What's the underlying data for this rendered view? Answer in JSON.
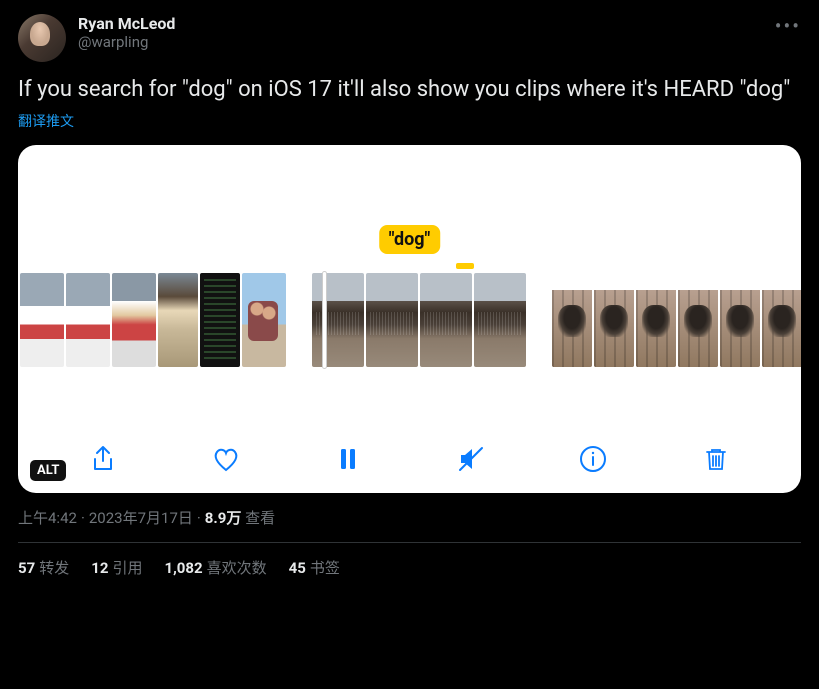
{
  "author": {
    "display_name": "Ryan McLeod",
    "handle": "@warpling"
  },
  "tweet_text": "If you search for \"dog\" on iOS 17 it'll also show you clips where it's HEARD \"dog\"",
  "translate_label": "翻译推文",
  "media": {
    "search_label": "\"dog\"",
    "alt_badge": "ALT"
  },
  "meta": {
    "time": "上午4:42",
    "date": "2023年7月17日",
    "views_number": "8.9万",
    "views_label": "查看"
  },
  "stats": {
    "retweets_num": "57",
    "retweets_label": "转发",
    "quotes_num": "12",
    "quotes_label": "引用",
    "likes_num": "1,082",
    "likes_label": "喜欢次数",
    "bookmarks_num": "45",
    "bookmarks_label": "书签"
  }
}
